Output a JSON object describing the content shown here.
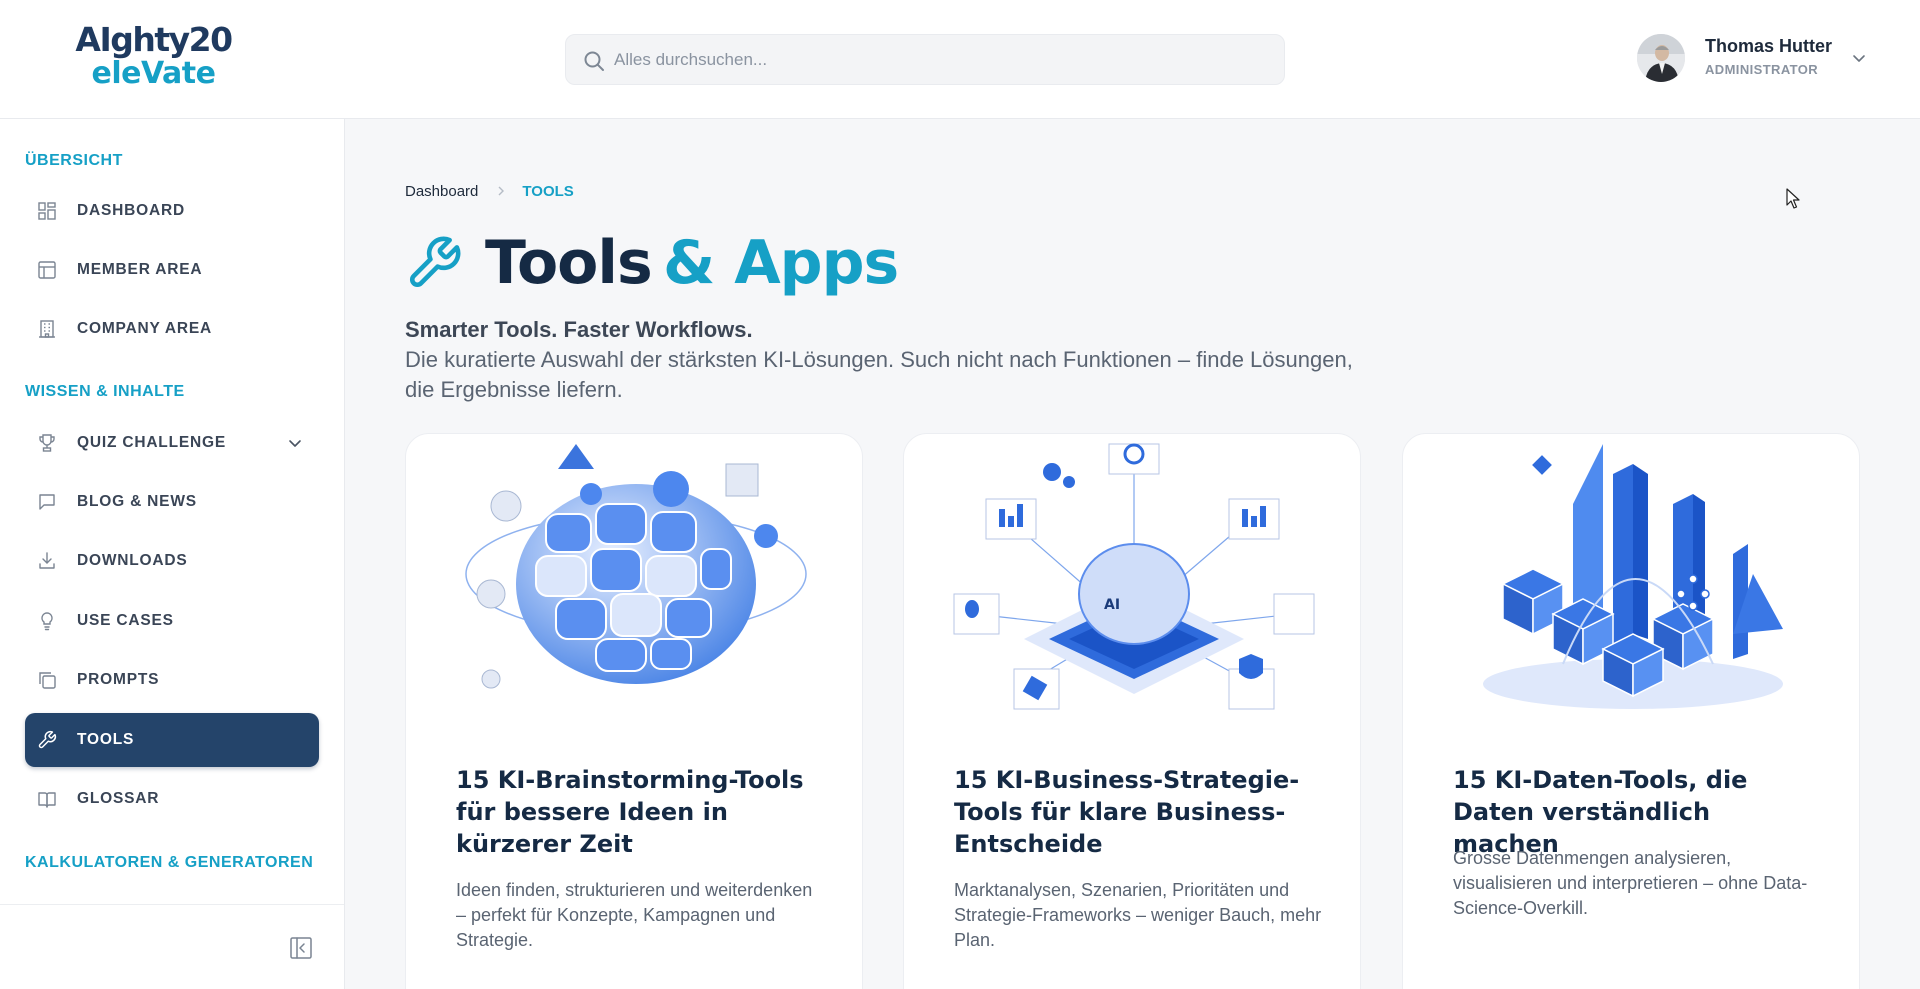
{
  "header": {
    "logo": {
      "line1": "AIghty",
      "line1_num": "20",
      "line2": "eleVate"
    },
    "search": {
      "placeholder": "Alles durchsuchen..."
    },
    "user": {
      "name": "Thomas Hutter",
      "role": "ADMINISTRATOR"
    }
  },
  "sidebar": {
    "sections": [
      {
        "title": "ÜBERSICHT"
      },
      {
        "title": "WISSEN & INHALTE"
      },
      {
        "title": "KALKULATOREN & GENERATOREN"
      }
    ],
    "items": [
      {
        "label": "DASHBOARD",
        "icon": "dashboard-icon"
      },
      {
        "label": "MEMBER AREA",
        "icon": "layout-icon"
      },
      {
        "label": "COMPANY AREA",
        "icon": "building-icon"
      },
      {
        "label": "QUIZ CHALLENGE",
        "icon": "trophy-icon"
      },
      {
        "label": "BLOG & NEWS",
        "icon": "message-icon"
      },
      {
        "label": "DOWNLOADS",
        "icon": "download-icon"
      },
      {
        "label": "USE CASES",
        "icon": "lightbulb-icon"
      },
      {
        "label": "PROMPTS",
        "icon": "copy-icon"
      },
      {
        "label": "TOOLS",
        "icon": "wrench-icon",
        "active": true
      },
      {
        "label": "GLOSSAR",
        "icon": "book-icon"
      }
    ]
  },
  "main": {
    "breadcrumb": {
      "home": "Dashboard",
      "current": "TOOLS"
    },
    "title_part1": "Tools",
    "title_part2": "& Apps",
    "subtitle": "Smarter Tools. Faster Workflows.",
    "description": "Die kuratierte Auswahl der stärksten KI-Lösungen. Such nicht nach Funktionen – finde Lösungen, die Ergebnisse liefern.",
    "cards": [
      {
        "title": "15 KI-Brainstorming-Tools für bessere Ideen in kürzerer Zeit",
        "description": "Ideen finden, strukturieren und weiterdenken – perfekt für Konzepte, Kampagnen und Strategie."
      },
      {
        "title": "15 KI-Business-Strategie-Tools für klare Business-Entscheide",
        "description": "Marktanalysen, Szenarien, Prioritäten und Strategie-Frameworks – weniger Bauch, mehr Plan."
      },
      {
        "title": "15 KI-Daten-Tools, die Daten verständlich machen",
        "description": "Grosse Datenmengen analysieren, visualisieren und interpretieren – ohne Data-Science-Overkill."
      }
    ]
  },
  "colors": {
    "accent": "#16a0c6",
    "navy": "#24446a",
    "title": "#152a44"
  }
}
